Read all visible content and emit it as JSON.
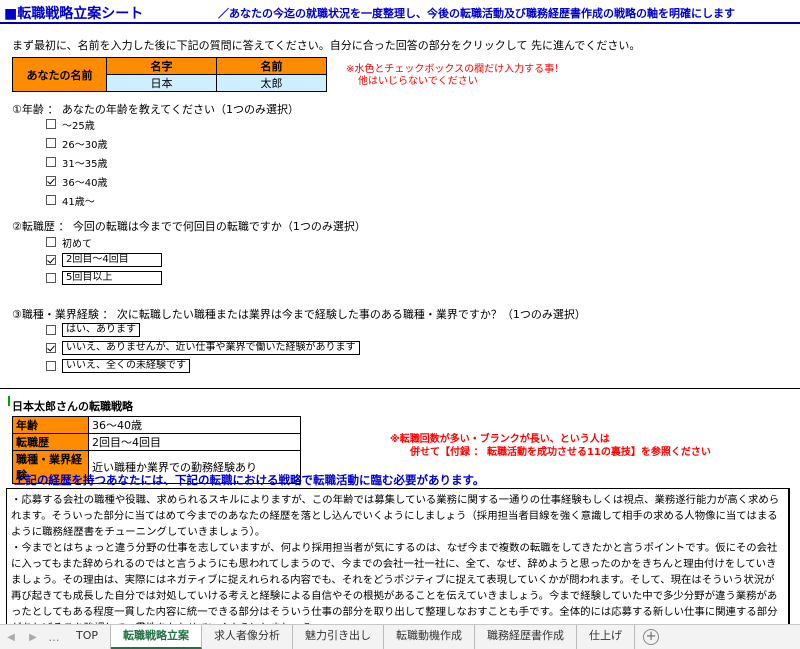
{
  "header": {
    "title": "■転職戦略立案シート",
    "subtitle": "／あなたの今迄の就職状況を一度整理し、今後の転職活動及び職務経歴書作成の戦略の軸を明確にします"
  },
  "intro": "まず最初に、名前を入力した後に下記の質問に答えてください。自分に合った回答の部分をクリックして 先に進んでください。",
  "name_table": {
    "label": "あなたの名前",
    "col1_header": "名字",
    "col2_header": "名前",
    "last_name": "日本",
    "first_name": "太郎"
  },
  "input_note": {
    "line1": "※水色とチェックボックスの欄だけ入力する事！",
    "line2": "他はいじらないでください"
  },
  "q1": {
    "text": "①年齢 ： あなたの年齢を教えてください（1つのみ選択）",
    "options": [
      {
        "label": "～25歳",
        "checked": false
      },
      {
        "label": "26～30歳",
        "checked": false
      },
      {
        "label": "31～35歳",
        "checked": false
      },
      {
        "label": "36～40歳",
        "checked": true
      },
      {
        "label": "41歳～",
        "checked": false
      }
    ]
  },
  "q2": {
    "text": "②転職歴 ： 今回の転職は今までで何回目の転職ですか（1つのみ選択）",
    "options": [
      {
        "label": "初めて",
        "checked": false
      },
      {
        "label": "2回目～4回目",
        "checked": true
      },
      {
        "label": "5回目以上",
        "checked": false
      }
    ]
  },
  "q3": {
    "text": "③職種・業界経験 ： 次に転職したい職種または業界は今まで経験した事のある職種・業界ですか？（1つのみ選択）",
    "options": [
      {
        "label": "はい、あります",
        "checked": false
      },
      {
        "label": "いいえ、ありませんが、近い仕事や業界で働いた経験があります",
        "checked": true
      },
      {
        "label": "いいえ、全くの未経験です",
        "checked": false
      }
    ]
  },
  "strategy": {
    "title": "日本太郎さんの転職戦略",
    "rows": [
      {
        "label": "年齢",
        "value": "36～40歳"
      },
      {
        "label": "転職歴",
        "value": "2回目～4回目"
      },
      {
        "label": "職種・業界経験",
        "value": "近い職種か業界での勤務経験あり"
      }
    ]
  },
  "strategy_note": {
    "line1": "※転職回数が多い・ブランクが長い、という人は",
    "line2": "併せて【付録 ： 転職活動を成功させる11の裏技】を参照ください"
  },
  "headline": "上記の経歴を持つあなたには、下記の転職における戦略で転職活動に臨む必要があります。",
  "advice": {
    "p1": "・応募する会社の職種や役職、求められるスキルによりますが、この年齢では募集している業務に関する一通りの仕事経験もしくは視点、業務遂行能力が高く求められます。そういった部分に当てはめて今までのあなたの経歴を落とし込んでいくようにしましょう（採用担当者目線を強く意識して相手の求める人物像に当てはまるように職務経歴書をチューニングしていきましょう）。",
    "p2": "・今までとはちょっと違う分野の仕事を志していますが、何より採用担当者が気にするのは、なぜ今まで複数の転職をしてきたかと言うポイントです。仮にその会社に入ってもまた辞められるのではと言うようにも思われてしまうので、今までの会社一社一社に、全て、なぜ、辞めようと思ったのかをきちんと理由付けをしていきましょう。その理由は、実際にはネガティブに捉えれられる内容でも、それをどうポジティブに捉えて表現していくかが問われます。そして、現在はそういう状況が再び起きても成長した自分では対処していける考えと経験による自信やその根拠があることを伝えていきましょう。今まで経験していた中で多少分野が違う業務があったとしてもある程度一貫した内容に統一できる部分はそういう仕事の部分を取り出して整理しなおすことも手です。全体的には応募する新しい仕事に関連する部分があればそこを強調して一貫性をもたせていくようにしましょう。"
  },
  "tabs": {
    "items": [
      "TOP",
      "転職戦略立案",
      "求人者像分析",
      "魅力引き出し",
      "転職動機作成",
      "職務経歴書作成",
      "仕上げ"
    ],
    "active": "転職戦略立案",
    "more": "…",
    "add": "+"
  }
}
